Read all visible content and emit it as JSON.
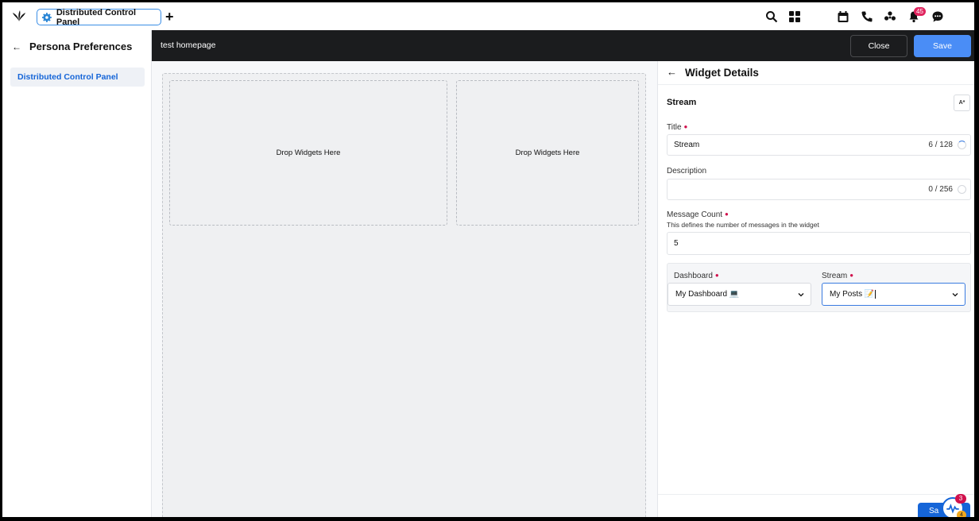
{
  "topbar": {
    "tab_label": "Distributed Control Panel",
    "new_tab_label": "+",
    "notification_count": "45",
    "icons": [
      "search-icon",
      "apps-grid-icon",
      "calendar-icon",
      "phone-icon",
      "community-icon",
      "bell-icon",
      "chat-icon"
    ]
  },
  "sidebar": {
    "title": "Persona Preferences",
    "items": [
      {
        "label": "Distributed Control Panel",
        "active": true
      }
    ]
  },
  "header": {
    "page_name": "test homepage",
    "close_label": "Close",
    "save_label": "Save"
  },
  "canvas": {
    "drop_zones": [
      "Drop Widgets Here",
      "Drop Widgets Here"
    ]
  },
  "panel": {
    "heading": "Widget Details",
    "section_title": "Stream",
    "aa_label": "A*",
    "title_field": {
      "label": "Title",
      "required": true,
      "value": "Stream",
      "count": "6 / 128"
    },
    "description_field": {
      "label": "Description",
      "required": false,
      "value": "",
      "count": "0 / 256"
    },
    "message_count_field": {
      "label": "Message Count",
      "required": true,
      "help": "This defines the number of messages in the widget",
      "value": "5"
    },
    "dashboard_select": {
      "label": "Dashboard",
      "required": true,
      "value": "My Dashboard 💻"
    },
    "stream_select": {
      "label": "Stream",
      "required": true,
      "value": "My Posts 📝"
    },
    "footer_save_label": "Sa"
  },
  "fab": {
    "badge_top": "3",
    "badge_bottom": "4"
  },
  "colors": {
    "accent": "#4a8df6",
    "primary": "#1565d8",
    "dark_header": "#1b1c1e",
    "required": "#d0104c"
  }
}
